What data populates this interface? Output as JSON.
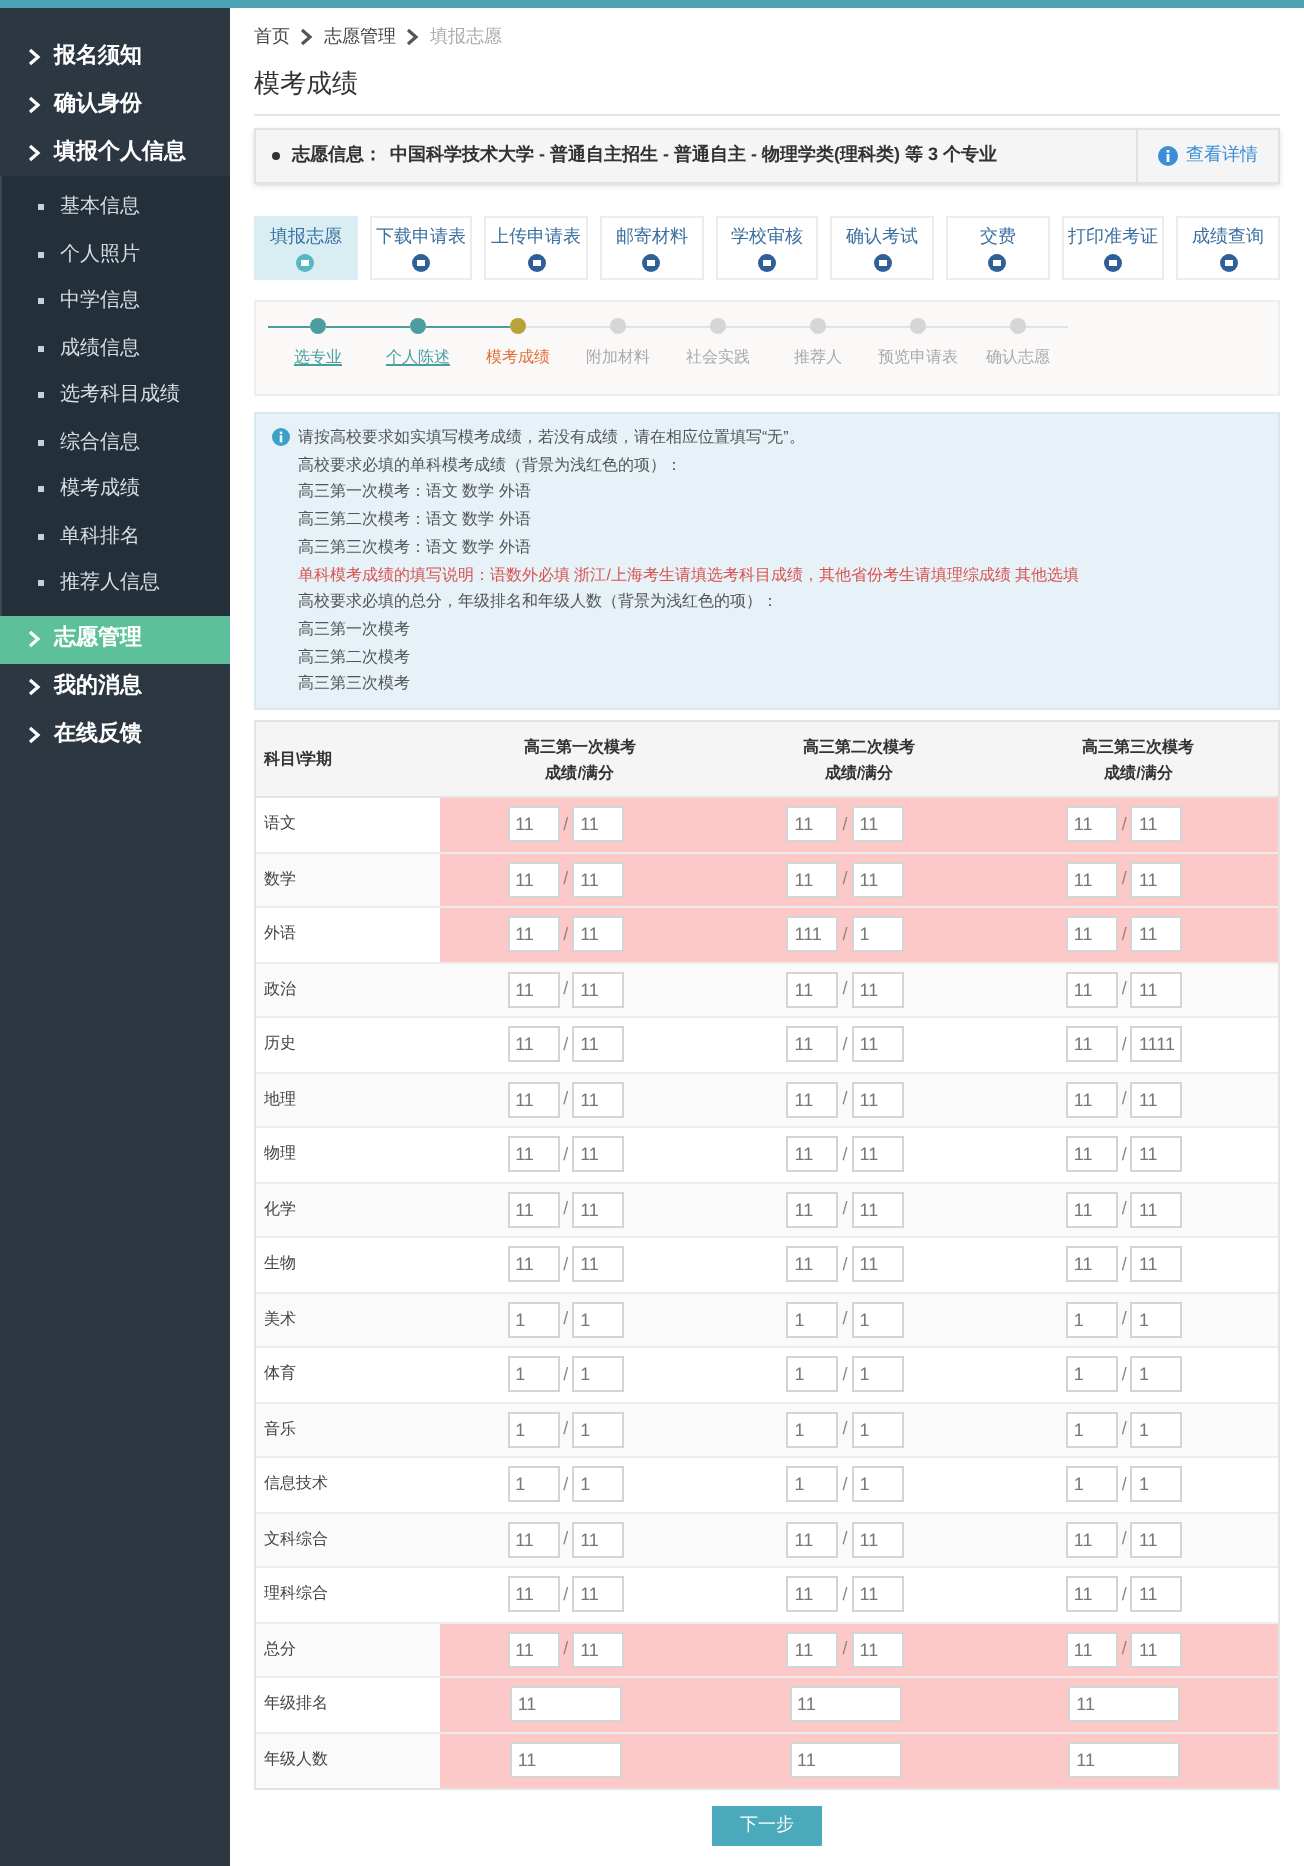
{
  "sidebar": {
    "items": [
      {
        "label": "报名须知",
        "selected": false
      },
      {
        "label": "确认身份",
        "selected": false
      },
      {
        "label": "填报个人信息",
        "selected": false,
        "expanded": true,
        "children": [
          {
            "label": "基本信息"
          },
          {
            "label": "个人照片"
          },
          {
            "label": "中学信息"
          },
          {
            "label": "成绩信息"
          },
          {
            "label": "选考科目成绩"
          },
          {
            "label": "综合信息"
          },
          {
            "label": "模考成绩"
          },
          {
            "label": "单科排名"
          },
          {
            "label": "推荐人信息"
          }
        ]
      },
      {
        "label": "志愿管理",
        "selected": true
      },
      {
        "label": "我的消息",
        "selected": false
      },
      {
        "label": "在线反馈",
        "selected": false
      }
    ]
  },
  "breadcrumb": [
    "首页",
    "志愿管理",
    "填报志愿"
  ],
  "page_title": "模考成绩",
  "info_bar": {
    "label": "志愿信息：",
    "text": "中国科学技术大学 - 普通自主招生 - 普通自主 - 物理学类(理科类) 等 3 个专业",
    "link": "查看详情"
  },
  "process_tabs": [
    {
      "label": "填报志愿",
      "selected": true
    },
    {
      "label": "下载申请表",
      "selected": false
    },
    {
      "label": "上传申请表",
      "selected": false
    },
    {
      "label": "邮寄材料",
      "selected": false
    },
    {
      "label": "学校审核",
      "selected": false
    },
    {
      "label": "确认考试",
      "selected": false
    },
    {
      "label": "交费",
      "selected": false
    },
    {
      "label": "打印准考证",
      "selected": false
    },
    {
      "label": "成绩查询",
      "selected": false
    }
  ],
  "steps": [
    {
      "label": "选专业",
      "completed": true,
      "current": false
    },
    {
      "label": "个人陈述",
      "completed": true,
      "current": false
    },
    {
      "label": "模考成绩",
      "completed": false,
      "current": true
    },
    {
      "label": "附加材料",
      "completed": false,
      "current": false
    },
    {
      "label": "社会实践",
      "completed": false,
      "current": false
    },
    {
      "label": "推荐人",
      "completed": false,
      "current": false
    },
    {
      "label": "预览申请表",
      "completed": false,
      "current": false
    },
    {
      "label": "确认志愿",
      "completed": false,
      "current": false
    }
  ],
  "notice": [
    {
      "text": "请按高校要求如实填写模考成绩，若没有成绩，请在相应位置填写“无”。",
      "kind": "normal"
    },
    {
      "text": "高校要求必填的单科模考成绩（背景为浅红色的项）：",
      "kind": "normal"
    },
    {
      "text": "高三第一次模考：语文 数学 外语",
      "kind": "normal"
    },
    {
      "text": "高三第二次模考：语文 数学 外语",
      "kind": "normal"
    },
    {
      "text": "高三第三次模考：语文 数学 外语",
      "kind": "normal"
    },
    {
      "text": "单科模考成绩的填写说明：语数外必填 浙江/上海考生请填选考科目成绩，其他省份考生请填理综成绩 其他选填",
      "kind": "warning"
    },
    {
      "text": "高校要求必填的总分，年级排名和年级人数（背景为浅红色的项）：",
      "kind": "normal"
    },
    {
      "text": "高三第一次模考",
      "kind": "normal"
    },
    {
      "text": "高三第二次模考",
      "kind": "normal"
    },
    {
      "text": "高三第三次模考",
      "kind": "normal"
    }
  ],
  "table": {
    "corner": "科目\\学期",
    "columns": [
      {
        "title": "高三第一次模考",
        "subtitle": "成绩/满分"
      },
      {
        "title": "高三第二次模考",
        "subtitle": "成绩/满分"
      },
      {
        "title": "高三第三次模考",
        "subtitle": "成绩/满分"
      }
    ],
    "separator": "/",
    "rows": [
      {
        "subject": "语文",
        "required": true,
        "kind": "pair",
        "cells": [
          [
            "11",
            "11"
          ],
          [
            "11",
            "11"
          ],
          [
            "11",
            "11"
          ]
        ]
      },
      {
        "subject": "数学",
        "required": true,
        "kind": "pair",
        "cells": [
          [
            "11",
            "11"
          ],
          [
            "11",
            "11"
          ],
          [
            "11",
            "11"
          ]
        ]
      },
      {
        "subject": "外语",
        "required": true,
        "kind": "pair",
        "cells": [
          [
            "11",
            "11"
          ],
          [
            "111",
            "1"
          ],
          [
            "11",
            "11"
          ]
        ]
      },
      {
        "subject": "政治",
        "required": false,
        "kind": "pair",
        "cells": [
          [
            "11",
            "11"
          ],
          [
            "11",
            "11"
          ],
          [
            "11",
            "11"
          ]
        ]
      },
      {
        "subject": "历史",
        "required": false,
        "kind": "pair",
        "cells": [
          [
            "11",
            "11"
          ],
          [
            "11",
            "11"
          ],
          [
            "11",
            "1111"
          ]
        ]
      },
      {
        "subject": "地理",
        "required": false,
        "kind": "pair",
        "cells": [
          [
            "11",
            "11"
          ],
          [
            "11",
            "11"
          ],
          [
            "11",
            "11"
          ]
        ]
      },
      {
        "subject": "物理",
        "required": false,
        "kind": "pair",
        "cells": [
          [
            "11",
            "11"
          ],
          [
            "11",
            "11"
          ],
          [
            "11",
            "11"
          ]
        ]
      },
      {
        "subject": "化学",
        "required": false,
        "kind": "pair",
        "cells": [
          [
            "11",
            "11"
          ],
          [
            "11",
            "11"
          ],
          [
            "11",
            "11"
          ]
        ]
      },
      {
        "subject": "生物",
        "required": false,
        "kind": "pair",
        "cells": [
          [
            "11",
            "11"
          ],
          [
            "11",
            "11"
          ],
          [
            "11",
            "11"
          ]
        ]
      },
      {
        "subject": "美术",
        "required": false,
        "kind": "pair",
        "cells": [
          [
            "1",
            "1"
          ],
          [
            "1",
            "1"
          ],
          [
            "1",
            "1"
          ]
        ]
      },
      {
        "subject": "体育",
        "required": false,
        "kind": "pair",
        "cells": [
          [
            "1",
            "1"
          ],
          [
            "1",
            "1"
          ],
          [
            "1",
            "1"
          ]
        ]
      },
      {
        "subject": "音乐",
        "required": false,
        "kind": "pair",
        "cells": [
          [
            "1",
            "1"
          ],
          [
            "1",
            "1"
          ],
          [
            "1",
            "1"
          ]
        ]
      },
      {
        "subject": "信息技术",
        "required": false,
        "kind": "pair",
        "cells": [
          [
            "1",
            "1"
          ],
          [
            "1",
            "1"
          ],
          [
            "1",
            "1"
          ]
        ]
      },
      {
        "subject": "文科综合",
        "required": false,
        "kind": "pair",
        "cells": [
          [
            "11",
            "11"
          ],
          [
            "11",
            "11"
          ],
          [
            "11",
            "11"
          ]
        ]
      },
      {
        "subject": "理科综合",
        "required": false,
        "kind": "pair",
        "cells": [
          [
            "11",
            "11"
          ],
          [
            "11",
            "11"
          ],
          [
            "11",
            "11"
          ]
        ]
      },
      {
        "subject": "总分",
        "required": true,
        "kind": "pair",
        "cells": [
          [
            "11",
            "11"
          ],
          [
            "11",
            "11"
          ],
          [
            "11",
            "11"
          ]
        ]
      },
      {
        "subject": "年级排名",
        "required": true,
        "kind": "single",
        "cells": [
          [
            "11"
          ],
          [
            "11"
          ],
          [
            "11"
          ]
        ]
      },
      {
        "subject": "年级人数",
        "required": true,
        "kind": "single",
        "cells": [
          [
            "11"
          ],
          [
            "11"
          ],
          [
            "11"
          ]
        ]
      }
    ]
  },
  "next_button": "下一步"
}
